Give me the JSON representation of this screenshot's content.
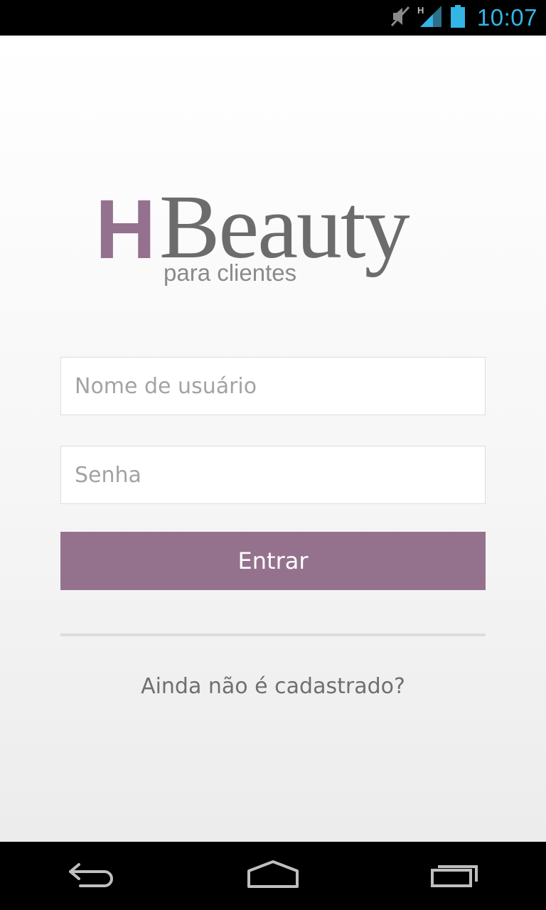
{
  "status_bar": {
    "time": "10:07",
    "network_label": "H",
    "icons": [
      "muted-icon",
      "signal-icon",
      "battery-icon"
    ]
  },
  "logo": {
    "letter": "H",
    "word": "Beauty",
    "subtitle": "para clientes",
    "colors": {
      "accent": "#94718f",
      "text": "#6d6c6c"
    }
  },
  "form": {
    "username_placeholder": "Nome de usuário",
    "password_placeholder": "Senha",
    "login_label": "Entrar"
  },
  "signup": {
    "label": "Ainda não é cadastrado?"
  },
  "nav_bar": {
    "icons": [
      "back-icon",
      "home-icon",
      "recent-apps-icon"
    ]
  },
  "colors": {
    "button": "#94728d",
    "status_accent": "#33b5e5"
  }
}
